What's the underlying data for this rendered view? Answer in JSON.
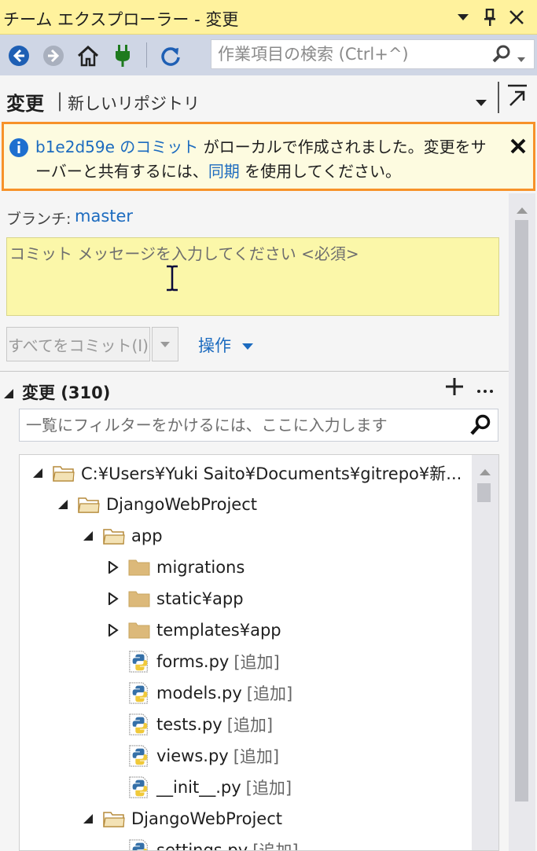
{
  "window": {
    "title": "チーム エクスプローラー - 変更"
  },
  "toolbar": {
    "search_placeholder": "作業項目の検索 (Ctrl+^)"
  },
  "page": {
    "title": "変更",
    "separator": "|",
    "subtitle": "新しいリポジトリ"
  },
  "notification": {
    "commit_link": "b1e2d59e のコミット",
    "text_a": " がローカルで作成されました。変更をサーバーと共有するには、",
    "sync_link": "同期",
    "text_b": " を使用してください。"
  },
  "branch": {
    "label": "ブランチ:",
    "value": "master"
  },
  "commit": {
    "message_placeholder": "コミット メッセージを入力してください <必須>",
    "button_label": "すべてをコミット(I)",
    "actions_label": "操作"
  },
  "changes": {
    "header": "変更 (310)",
    "filter_placeholder": "一覧にフィルターをかけるには、ここに入力します",
    "tree": [
      {
        "name": "C:¥Users¥Yuki Saito¥Documents¥gitrepo¥新...",
        "tag": "",
        "kind": "folder-open"
      },
      {
        "name": "DjangoWebProject",
        "tag": "",
        "kind": "folder-open"
      },
      {
        "name": "app",
        "tag": "",
        "kind": "folder-open"
      },
      {
        "name": "migrations",
        "tag": "",
        "kind": "folder-closed"
      },
      {
        "name": "static¥app",
        "tag": "",
        "kind": "folder-closed"
      },
      {
        "name": "templates¥app",
        "tag": "",
        "kind": "folder-closed"
      },
      {
        "name": "forms.py",
        "tag": "[追加]",
        "kind": "python-file"
      },
      {
        "name": "models.py",
        "tag": "[追加]",
        "kind": "python-file"
      },
      {
        "name": "tests.py",
        "tag": "[追加]",
        "kind": "python-file"
      },
      {
        "name": "views.py",
        "tag": "[追加]",
        "kind": "python-file"
      },
      {
        "name": "__init__.py",
        "tag": "[追加]",
        "kind": "python-file"
      },
      {
        "name": "DjangoWebProject",
        "tag": "",
        "kind": "folder-open"
      },
      {
        "name": "settings.py",
        "tag": "[追加]",
        "kind": "python-file"
      }
    ]
  },
  "colors": {
    "title_bar": "#fff29d",
    "toolbar": "#cfd6e5",
    "notification_border": "#f7922a",
    "link": "#1c6bbf",
    "message_box": "#fbf7a9"
  }
}
